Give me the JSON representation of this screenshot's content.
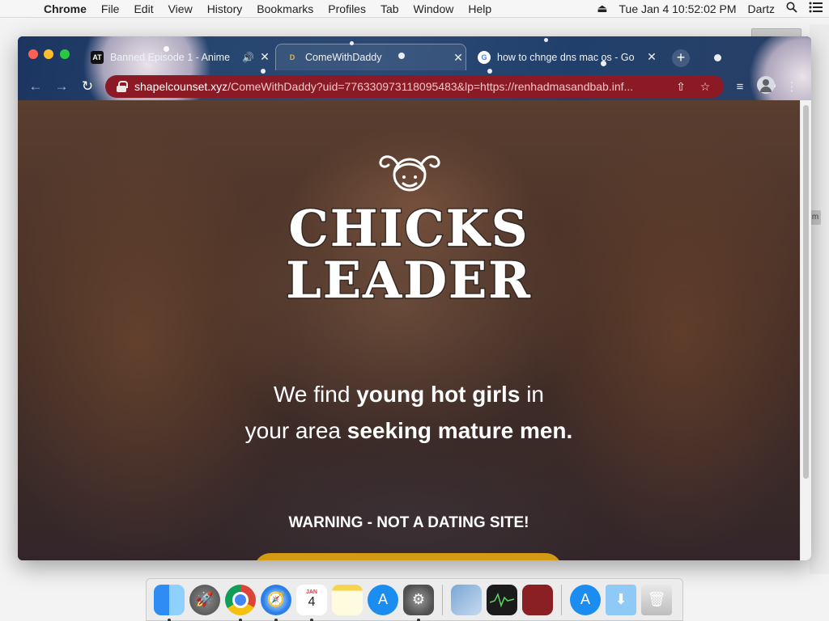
{
  "menubar": {
    "app_name": "Chrome",
    "items": [
      "File",
      "Edit",
      "View",
      "History",
      "Bookmarks",
      "Profiles",
      "Tab",
      "Window",
      "Help"
    ],
    "clock": "Tue Jan 4  10:52:02 PM",
    "user": "Dartz"
  },
  "browser": {
    "tabs": [
      {
        "title": "Banned Episode 1 - Anime",
        "favicon": "AT",
        "audio": true,
        "active": false
      },
      {
        "title": "ComeWithDaddy",
        "favicon": "D",
        "audio": false,
        "active": true
      },
      {
        "title": "how to chnge dns mac os - Go",
        "favicon": "G",
        "audio": false,
        "active": false
      }
    ],
    "omnibox": {
      "host": "shapelcounset.xyz",
      "path": "/ComeWithDaddy?uid=776330973118095483&lp=https://renhadmasandbab.inf...",
      "insecure_color": "#8b1a24"
    }
  },
  "page": {
    "logo_line1": "CHICKS",
    "logo_line2": "LEADER",
    "tagline": {
      "line1_pre": "We find ",
      "line1_bold": "young hot girls",
      "line1_post": " in",
      "line2_pre": "your area ",
      "line2_bold": "seeking mature men."
    },
    "warning": "WARNING - NOT A DATING SITE!",
    "cta_color": "#d39a14"
  },
  "dock": {
    "calendar_month": "JAN",
    "calendar_day": "4",
    "items": [
      "Finder",
      "Launchpad",
      "Google Chrome",
      "Safari",
      "Calendar",
      "Notes",
      "App Store",
      "System Preferences",
      "Preview",
      "Activity Monitor",
      "Photo Booth",
      "App Store",
      "Downloads",
      "Trash"
    ]
  }
}
